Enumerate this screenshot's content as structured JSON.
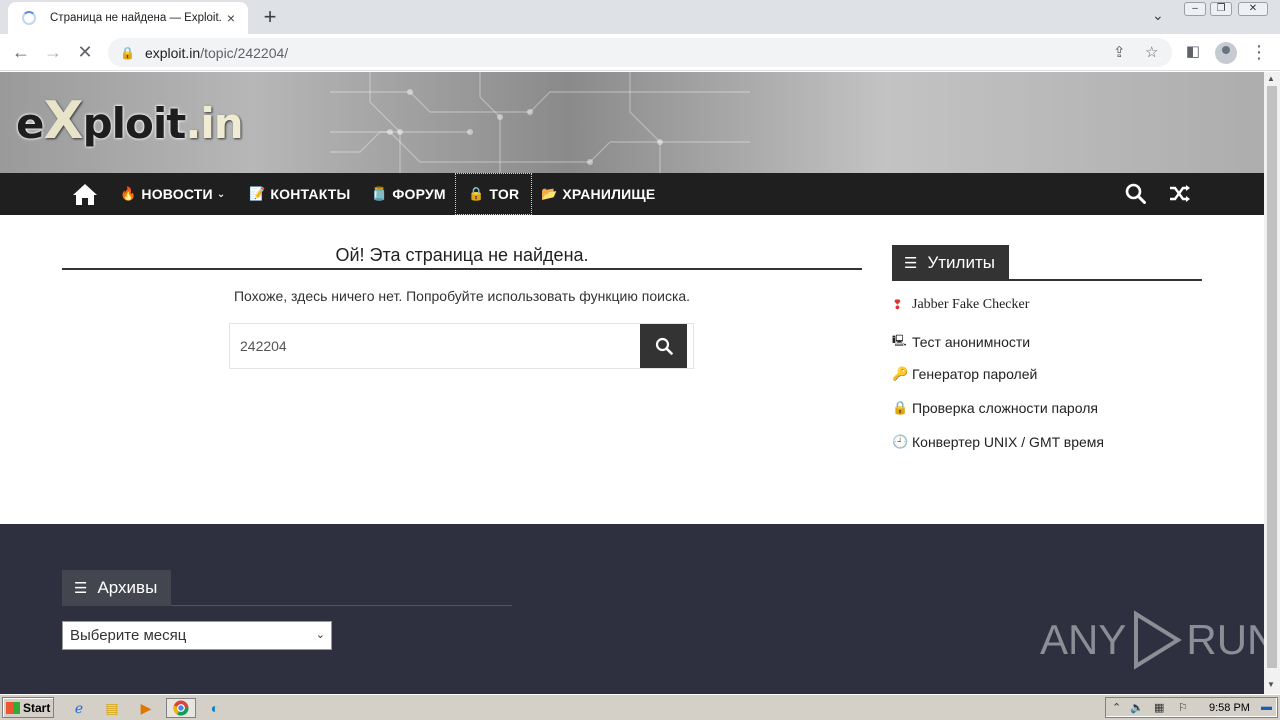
{
  "browser": {
    "tab_title": "Страница не найдена — Exploit.IN",
    "tab_close": "×",
    "new_tab": "+",
    "url_host": "exploit.in",
    "url_path": "/topic/242204/",
    "window_controls": [
      "–",
      "❐",
      "✕"
    ]
  },
  "site": {
    "logo_part1": "e",
    "logo_x": "X",
    "logo_part2": "ploit",
    "logo_part3": ".in",
    "nav": [
      {
        "icon": "fire-icon",
        "label": "Новости",
        "has_dropdown": true
      },
      {
        "icon": "memo-icon",
        "label": "Контакты"
      },
      {
        "icon": "jar-icon",
        "label": "Форум"
      },
      {
        "icon": "lock-icon",
        "label": "TOR",
        "active": true
      },
      {
        "icon": "folder-icon",
        "label": "Хранилище"
      }
    ]
  },
  "main": {
    "title": "Ой! Эта страница не найдена.",
    "message": "Похоже, здесь ничего нет. Попробуйте использовать функцию поиска.",
    "search_value": "242204"
  },
  "sidebar": {
    "widget_title": "Утилиты",
    "items": [
      {
        "icon": "jabber-icon",
        "label": "Jabber Fake Checker"
      },
      {
        "icon": "ip-icon",
        "label": "Тест анонимности"
      },
      {
        "icon": "key-icon",
        "label": "Генератор паролей"
      },
      {
        "icon": "padlock-icon",
        "label": "Проверка сложности пароля"
      },
      {
        "icon": "clock-icon",
        "label": "Конвертер UNIX / GMT время"
      }
    ]
  },
  "footer": {
    "widget_title": "Архивы",
    "select_value": "Выберите месяц",
    "watermark_left": "ANY",
    "watermark_right": "RUN"
  },
  "taskbar": {
    "start_label": "Start",
    "clock": "9:58 PM"
  }
}
